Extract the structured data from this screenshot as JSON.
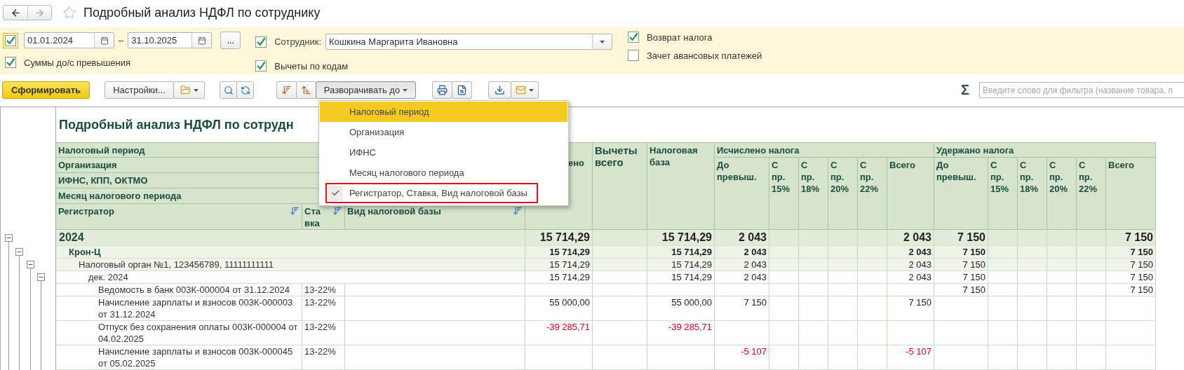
{
  "window": {
    "title": "Подробный анализ НДФЛ по сотруднику",
    "favorite": false
  },
  "nav": {
    "back": {
      "disabled": false
    },
    "forward": {
      "disabled": true
    }
  },
  "filters": {
    "period": {
      "checked": true,
      "focused": true,
      "from": "01.01.2024",
      "separator": "–",
      "to": "31.10.2025",
      "more_button": "..."
    },
    "employee": {
      "checked": true,
      "label": "Сотрудник:",
      "value": "Кошкина Маргарита Ивановна"
    },
    "options": [
      {
        "label": "Суммы до/с превышения",
        "checked": true
      },
      {
        "label": "Вычеты по кодам",
        "checked": true
      },
      {
        "label": "Возврат налога",
        "checked": true
      },
      {
        "label": "Зачет авансовых платежей",
        "checked": false
      }
    ]
  },
  "toolbar": {
    "generate_button": "Сформировать",
    "settings_button": "Настройки...",
    "expand_button": {
      "label": "Разворачивать до",
      "open": true
    },
    "sum_sign": "Σ",
    "filter_field": {
      "placeholder": "Введите слово для фильтра (название товара, п"
    }
  },
  "expand_menu": [
    {
      "label": "Налоговый период",
      "selected": true,
      "checked": false,
      "outlined": false
    },
    {
      "label": "Организация",
      "selected": false,
      "checked": false,
      "outlined": false
    },
    {
      "label": "ИФНС",
      "selected": false,
      "checked": false,
      "outlined": false
    },
    {
      "label": "Месяц налогового периода",
      "selected": false,
      "checked": false,
      "outlined": false
    },
    {
      "label": "Регистратор, Ставка, Вид налоговой базы",
      "selected": false,
      "checked": true,
      "outlined": true
    }
  ],
  "report": {
    "title": "Подробный анализ НДФЛ по сотрудн",
    "grouping_headers": [
      "Налоговый период",
      "Организация",
      "ИФНС, КПП, ОКТМО",
      "Месяц налогового периода"
    ],
    "detail_columns": [
      "Регистратор",
      "Ставка",
      "Вид налоговой базы"
    ],
    "amount_columns": [
      {
        "label": "ено",
        "large": false
      },
      {
        "label": "Вычеты всего",
        "large": true
      },
      {
        "label": "Налоговая база",
        "large": false
      }
    ],
    "groups": [
      {
        "label": "Исчислено налога",
        "columns": [
          "До превыш.",
          "С пр. 15%",
          "С пр. 18%",
          "С пр. 20%",
          "С пр. 22%",
          "Всего"
        ]
      },
      {
        "label": "Удержано налога",
        "columns": [
          "До превыш.",
          "С пр. 15%",
          "С пр. 18%",
          "С пр. 20%",
          "С пр. 22%",
          "Всего"
        ]
      }
    ],
    "rows": [
      {
        "kind": "group",
        "name": "2024",
        "expanded": true,
        "negative": false,
        "amounts": {
          "column_1": "15 714,29",
          "tax_base": "15 714,29",
          "calculated_before": "2 043",
          "calculated_total": "2 043",
          "withheld_before": "7 150",
          "withheld_total": "7 150"
        },
        "children": [
          {
            "kind": "group",
            "name": "Крон-Ц",
            "expanded": true,
            "negative": false,
            "amounts": {
              "column_1": "15 714,29",
              "tax_base": "15 714,29",
              "calculated_before": "2 043",
              "calculated_total": "2 043",
              "withheld_before": "7 150",
              "withheld_total": "7 150"
            },
            "children": [
              {
                "kind": "group",
                "name": "Налоговый орган №1, 123456789, 11111111111",
                "expanded": true,
                "negative": false,
                "amounts": {
                  "column_1": "15 714,29",
                  "tax_base": "15 714,29",
                  "calculated_before": "2 043",
                  "calculated_total": "2 043",
                  "withheld_before": "7 150",
                  "withheld_total": "7 150"
                },
                "children": [
                  {
                    "kind": "group",
                    "name": "дек. 2024",
                    "expanded": true,
                    "negative": false,
                    "amounts": {
                      "column_1": "15 714,29",
                      "tax_base": "15 714,29",
                      "calculated_before": "2 043",
                      "calculated_total": "2 043",
                      "withheld_before": "7 150",
                      "withheld_total": "7 150"
                    },
                    "children": [
                      {
                        "kind": "document",
                        "name": "Ведомость в банк 003К-000004 от 31.12.2024",
                        "rate": "13-22%",
                        "negative": false,
                        "amounts": {
                          "withheld_before": "7 150",
                          "withheld_total": "7 150"
                        }
                      },
                      {
                        "kind": "document",
                        "name": "Начисление зарплаты и взносов 003К-000003 от 31.12.2024",
                        "rate": "13-22%",
                        "negative": false,
                        "amounts": {
                          "column_1": "55 000,00",
                          "tax_base": "55 000,00",
                          "calculated_before": "7 150",
                          "calculated_total": "7 150"
                        }
                      },
                      {
                        "kind": "document",
                        "name": "Отпуск без сохранения оплаты 003К-000004 от 04.02.2025",
                        "rate": "13-22%",
                        "negative": true,
                        "amounts": {
                          "column_1": "-39 285,71",
                          "tax_base": "-39 285,71"
                        }
                      },
                      {
                        "kind": "document",
                        "name": "Начисление зарплаты и взносов 003К-000045 от 05.02.2025",
                        "rate": "13-22%",
                        "negative": true,
                        "amounts": {
                          "calculated_before": "-5 107",
                          "calculated_total": "-5 107"
                        }
                      }
                    ]
                  }
                ]
              }
            ]
          }
        ]
      }
    ]
  }
}
